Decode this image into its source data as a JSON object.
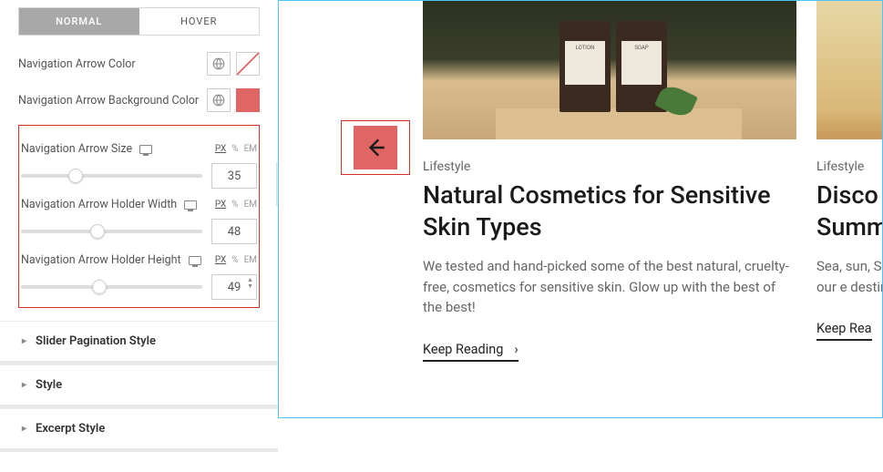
{
  "tabs": {
    "normal": "NORMAL",
    "hover": "HOVER"
  },
  "labels": {
    "arrowColor": "Navigation Arrow Color",
    "arrowBg": "Navigation Arrow Background Color",
    "arrowSize": "Navigation Arrow Size",
    "holderWidth": "Navigation Arrow Holder Width",
    "holderHeight": "Navigation Arrow Holder Height"
  },
  "units": {
    "px": "PX",
    "pct": "%",
    "em": "EM"
  },
  "values": {
    "size": "35",
    "width": "48",
    "height": "49"
  },
  "sliderPos": {
    "size": 30,
    "width": 42,
    "height": 43
  },
  "colors": {
    "bgSwatch": "#e06666"
  },
  "accordions": {
    "pagination": "Slider Pagination Style",
    "style": "Style",
    "excerpt": "Excerpt Style"
  },
  "preview": {
    "card1": {
      "category": "Lifestyle",
      "title": "Natural Cosmetics for Sensitive Skin Types",
      "desc": "We tested and hand-picked some of the best natural, cruelty-free, cosmetics for sensitive skin. Glow up with the best of the best!",
      "cta": "Keep Reading",
      "bottle1": "LOTION",
      "bottle2": "SOAP"
    },
    "card2": {
      "category": "Lifestyle",
      "title": "Disco Summ",
      "desc": "Sea, sun, See our e destinati",
      "cta": "Keep Rea"
    }
  }
}
